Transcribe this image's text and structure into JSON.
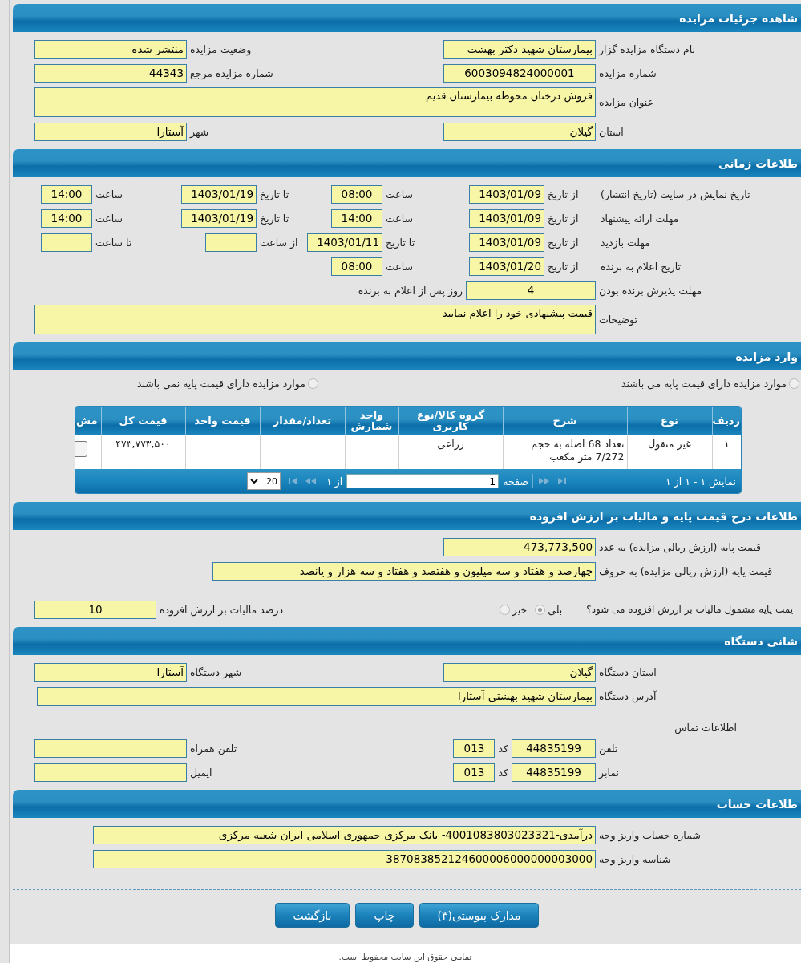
{
  "sections": [
    {
      "kind": "form",
      "title": "شاهده جزئیات مزایده",
      "rows": [
        [
          {
            "kind": "head",
            "text": "نام دستگاه مزایده گزار"
          },
          {
            "kind": "text",
            "value": "بیمارستان شهید دکتر بهشت"
          },
          {
            "kind": "col",
            "text": "وضعیت مزایده"
          },
          {
            "kind": "text",
            "value": "منتشر شده"
          }
        ],
        [
          {
            "kind": "head",
            "text": "شماره مزایده"
          },
          {
            "kind": "number",
            "value": "6003094824000001"
          },
          {
            "kind": "col",
            "text": "شماره مزایده مرجع"
          },
          {
            "kind": "text",
            "value": "44343"
          }
        ],
        [
          {
            "kind": "head",
            "text": "عنوان مزایده"
          },
          {
            "kind": "memo",
            "value": "فروش درختان محوطه بیمارستان قدیم"
          }
        ],
        [
          {
            "kind": "head",
            "text": "استان"
          },
          {
            "kind": "text",
            "value": "گیلان"
          },
          {
            "kind": "col",
            "text": "شهر"
          },
          {
            "kind": "text",
            "value": "آستارا"
          }
        ]
      ]
    },
    {
      "kind": "form",
      "title": "طلاعات زمانی",
      "rows": [
        [
          {
            "kind": "head",
            "text": "تاریخ نمایش در سایت (تاریخ انتشار)"
          },
          {
            "kind": "label",
            "text": "از تاریخ"
          },
          {
            "kind": "date",
            "value": "1403/01/09"
          },
          {
            "kind": "label",
            "text": "ساعت"
          },
          {
            "kind": "time",
            "value": "08:00"
          },
          {
            "kind": "label",
            "text": "تا تاریخ"
          },
          {
            "kind": "date",
            "value": "1403/01/19"
          },
          {
            "kind": "label",
            "text": "ساعت"
          },
          {
            "kind": "time",
            "value": "14:00"
          }
        ],
        [
          {
            "kind": "head",
            "text": "مهلت ارائه پیشنهاد"
          },
          {
            "kind": "label",
            "text": "از تاریخ"
          },
          {
            "kind": "date",
            "value": "1403/01/09"
          },
          {
            "kind": "label",
            "text": "ساعت"
          },
          {
            "kind": "time",
            "value": "14:00"
          },
          {
            "kind": "label",
            "text": "تا تاریخ"
          },
          {
            "kind": "date",
            "value": "1403/01/19"
          },
          {
            "kind": "label",
            "text": "ساعت"
          },
          {
            "kind": "time",
            "value": "14:00"
          }
        ],
        [
          {
            "kind": "head",
            "text": "مهلت بازدید"
          },
          {
            "kind": "label",
            "text": "از تاریخ"
          },
          {
            "kind": "date",
            "value": "1403/01/09"
          },
          {
            "kind": "label",
            "text": "تا تاریخ"
          },
          {
            "kind": "date",
            "value": "1403/01/11"
          },
          {
            "kind": "label",
            "text": "از ساعت"
          },
          {
            "kind": "time"
          },
          {
            "kind": "label",
            "text": "تا ساعت"
          },
          {
            "kind": "time"
          }
        ],
        [
          {
            "kind": "head",
            "text": "تاریخ اعلام به برنده"
          },
          {
            "kind": "label",
            "text": "از تاریخ"
          },
          {
            "kind": "date",
            "value": "1403/01/20"
          },
          {
            "kind": "label",
            "text": "ساعت"
          },
          {
            "kind": "time",
            "value": "08:00"
          }
        ],
        [
          {
            "kind": "head",
            "text": "مهلت پذیرش برنده بودن"
          },
          {
            "kind": "count",
            "value": "4",
            "suffix": "روز پس از اعلام به برنده"
          }
        ],
        [
          {
            "kind": "head",
            "text": "توضیحات"
          },
          {
            "kind": "memo",
            "value": "قیمت پیشنهادی خود را اعلام نمایید"
          }
        ]
      ]
    },
    {
      "kind": "items",
      "title": "وارد مزایده",
      "radios": [
        {
          "text": "موارد مزایده دارای قیمت پایه می باشند",
          "selected": false
        },
        {
          "text": "موارد مزایده دارای قیمت پایه نمی باشند",
          "selected": false
        }
      ],
      "table": {
        "columns": [
          "ردیف",
          "نوع",
          "شرح",
          "گروه کالا/نوع کاربری",
          "واحد شمارش",
          "تعداد/مقدار",
          "قیمت واحد",
          "قیمت کل",
          "مش"
        ],
        "rows": [
          {
            "index": "۱",
            "type": "غیر منقول",
            "description": "تعداد 68 اصله به حجم 7/272 متر مکعب",
            "group": "زراعی",
            "total_price": "۴۷۳,۷۷۳,۵۰۰"
          }
        ],
        "pager": {
          "summary": "نمایش ۱ - ۱ از ۱",
          "page_label": "صفحه",
          "page": "1",
          "of": "از ۱",
          "page_size": "20"
        }
      }
    },
    {
      "kind": "form",
      "title": "طلاعات درج قیمت پایه و مالیات بر ارزش افزوده",
      "rows": [
        [
          {
            "kind": "head",
            "text": "قیمت پایه (ارزش ریالی مزایده) به عدد"
          },
          {
            "kind": "text",
            "value": "473,773,500"
          }
        ],
        [
          {
            "kind": "head",
            "text": "قیمت پایه (ارزش ریالی مزایده) به حروف"
          },
          {
            "kind": "words",
            "value": "چهارصد و هفتاد و سه میلیون و هفتصد و هفتاد و سه هزار و پانصد"
          }
        ],
        [
          {
            "kind": "question",
            "text": "یمت پایه مشمول مالیات بر ارزش افزوده می شود؟"
          },
          {
            "kind": "radio",
            "text": "بلی",
            "selected": true
          },
          {
            "kind": "radio",
            "text": "خیر",
            "selected": false
          },
          {
            "kind": "col",
            "text": "درصد مالیات بر ارزش افزوده"
          },
          {
            "kind": "percent",
            "value": "10"
          }
        ]
      ]
    },
    {
      "kind": "form",
      "title": "شانی دستگاه",
      "rows": [
        [
          {
            "kind": "head",
            "text": "استان دستگاه"
          },
          {
            "kind": "text",
            "value": "گیلان"
          },
          {
            "kind": "col",
            "text": "شهر دستگاه"
          },
          {
            "kind": "text",
            "value": "آستارا"
          }
        ],
        [
          {
            "kind": "head",
            "text": "آدرس دستگاه"
          },
          {
            "kind": "long",
            "value": "بیمارستان شهید بهشتی آستارا"
          }
        ],
        [
          {
            "kind": "note",
            "text": "اطلاعات تماس"
          }
        ],
        [
          {
            "kind": "head",
            "text": "تلفن"
          },
          {
            "kind": "phone",
            "value": "44835199",
            "code_label": "کد",
            "code": "013"
          },
          {
            "kind": "col",
            "text": "تلفن همراه"
          },
          {
            "kind": "text"
          }
        ],
        [
          {
            "kind": "head",
            "text": "نمابر"
          },
          {
            "kind": "phone",
            "value": "44835199",
            "code_label": "کد",
            "code": "013"
          },
          {
            "kind": "col",
            "text": "ایمیل"
          },
          {
            "kind": "text"
          }
        ]
      ]
    },
    {
      "kind": "form",
      "title": "طلاعات حساب",
      "rows": [
        [
          {
            "kind": "head",
            "text": "شماره حساب واریز وجه"
          },
          {
            "kind": "account",
            "value": "درآمدی-4001083803023321- بانک مرکزی جمهوری اسلامی ایران شعبه مرکزی"
          }
        ],
        [
          {
            "kind": "head",
            "text": "شناسه واریز وجه"
          },
          {
            "kind": "account",
            "value": "387083852124600006000000003000"
          }
        ]
      ]
    }
  ],
  "buttons": [
    "مدارک پیوستی(۳)",
    "چاپ",
    "بازگشت"
  ],
  "footer": "تمامی حقوق این سایت محفوظ است."
}
